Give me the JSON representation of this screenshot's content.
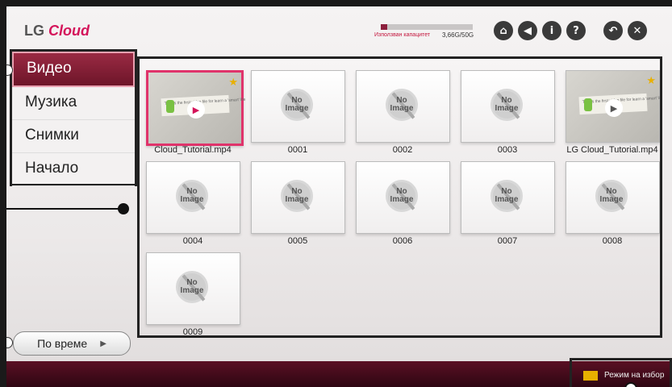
{
  "header": {
    "logo_prefix": "LG ",
    "logo_brand": "Cloud",
    "storage_label": "Използван капацитет",
    "storage_value": "3,66G/50G",
    "storage_used_fraction": 0.073
  },
  "toolbar_icons": [
    "home-icon",
    "back-arrow-icon",
    "info-icon",
    "help-icon",
    "return-icon",
    "close-icon"
  ],
  "sidebar": {
    "items": [
      {
        "label": "Видео",
        "active": true
      },
      {
        "label": "Музика",
        "active": false
      },
      {
        "label": "Снимки",
        "active": false
      },
      {
        "label": "Начало",
        "active": false
      }
    ],
    "sort_label": "По време"
  },
  "grid": {
    "items": [
      {
        "caption": "Cloud_Tutorial.mp4",
        "type": "video",
        "selected": true
      },
      {
        "caption": "0001",
        "type": "noimage"
      },
      {
        "caption": "0002",
        "type": "noimage"
      },
      {
        "caption": "0003",
        "type": "noimage"
      },
      {
        "caption": "LG Cloud_Tutorial.mp4",
        "type": "video"
      },
      {
        "caption": "0004",
        "type": "noimage"
      },
      {
        "caption": "0005",
        "type": "noimage"
      },
      {
        "caption": "0006",
        "type": "noimage"
      },
      {
        "caption": "0007",
        "type": "noimage"
      },
      {
        "caption": "0008",
        "type": "noimage"
      },
      {
        "caption": "0009",
        "type": "noimage"
      }
    ],
    "noimage_text": "No Image",
    "video_card_text": "This is the first video file for learn a 'smart' life"
  },
  "footer": {
    "select_mode_label": "Режим на избор",
    "select_key_label": "..."
  }
}
